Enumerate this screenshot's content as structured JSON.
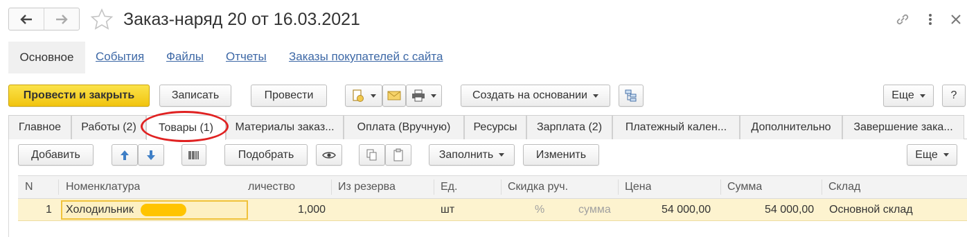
{
  "window": {
    "title": "Заказ-наряд 20 от 16.03.2021",
    "icons": {
      "back": "arrow-left-icon",
      "forward": "arrow-right-icon",
      "favorite": "star-icon",
      "link": "link-icon",
      "more": "more-vertical-icon",
      "close": "close-icon"
    }
  },
  "sections": {
    "active": "Основное",
    "links": [
      "События",
      "Файлы",
      "Отчеты",
      "Заказы покупателей с сайта"
    ]
  },
  "toolbar": {
    "post_close": "Провести и закрыть",
    "save": "Записать",
    "post": "Провести",
    "create_based": "Создать на основании",
    "more": "Еще",
    "help": "?"
  },
  "tabs": [
    "Главное",
    "Работы (2)",
    "Товары (1)",
    "Материалы заказ...",
    "Оплата (Вручную)",
    "Ресурсы",
    "Зарплата (2)",
    "Платежный кален...",
    "Дополнительно",
    "Завершение зака..."
  ],
  "active_tab": "Товары (1)",
  "table_toolbar": {
    "add": "Добавить",
    "pick": "Подобрать",
    "fill": "Заполнить",
    "edit": "Изменить",
    "more": "Еще"
  },
  "table": {
    "columns": [
      "N",
      "Номенклатура",
      "личество",
      "Из резерва",
      "Ед.",
      "Скидка руч.",
      "Цена",
      "Сумма",
      "Склад"
    ],
    "rows": [
      {
        "n": "1",
        "item": "Холодильник",
        "qty": "1,000",
        "reserve": "",
        "unit": "шт",
        "discount_pct": "%",
        "discount_sum": "сумма",
        "price": "54 000,00",
        "sum": "54 000,00",
        "warehouse": "Основной склад"
      }
    ]
  },
  "colors": {
    "primary_button": "#f5d328",
    "link": "#3d68a6",
    "selected_row": "#fdf3cf",
    "annotation": "#e02222"
  }
}
